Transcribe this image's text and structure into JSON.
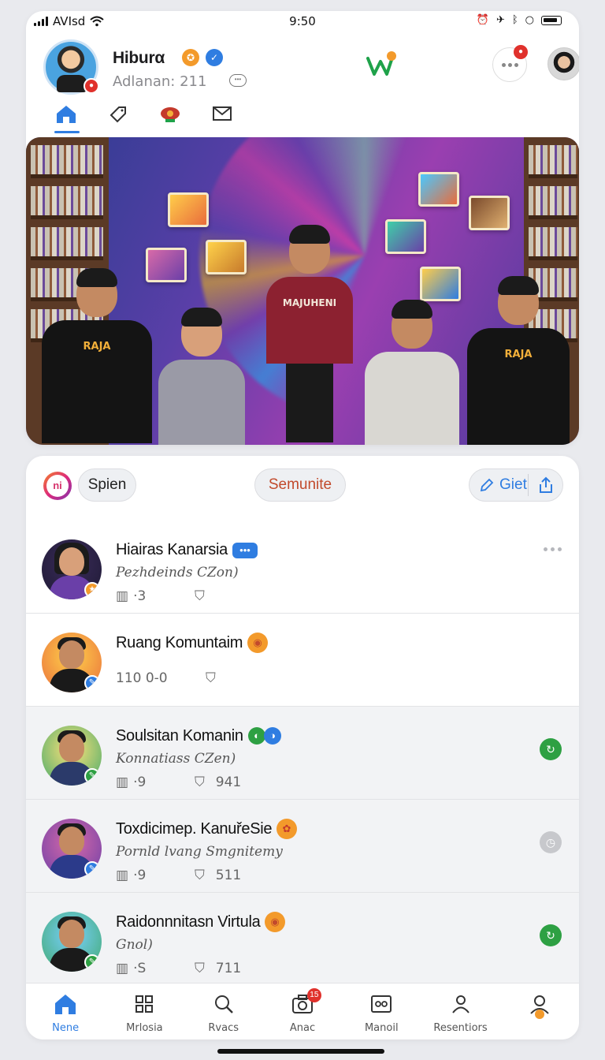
{
  "status_bar": {
    "carrier": "AVIsd",
    "time": "9:50"
  },
  "profile": {
    "name": "Hiburα",
    "subtitle": "Adlanan: 211"
  },
  "filters": {
    "spen": "Spien",
    "semunite": "Semunite",
    "giet": "Giet"
  },
  "list": [
    {
      "title": "Hiairas Kanarsia",
      "subtitle": "Pezhdeinds CZon)",
      "meta_a": "·3",
      "meta_b": "",
      "right": "more",
      "shaded": false
    },
    {
      "title": "Ruang Komuntaim",
      "subtitle": "",
      "meta_a": "110 0-0",
      "meta_b": "",
      "right": "",
      "shaded": false
    },
    {
      "title": "Soulsitan Komanin",
      "subtitle": "Konnatiass CZen)",
      "meta_a": "·9",
      "meta_b": "941",
      "right": "green",
      "shaded": true
    },
    {
      "title": "Toxdicimep. KanuřeSie",
      "subtitle": "Pornld lvang Smgnitemy",
      "meta_a": "·9",
      "meta_b": "511",
      "right": "gray",
      "shaded": true
    },
    {
      "title": "Raidonnnitasn Virtula",
      "subtitle": "Gnol)",
      "meta_a": "·S",
      "meta_b": "711",
      "right": "green",
      "shaded": true
    }
  ],
  "bottom_nav": [
    {
      "label": "Nene",
      "icon": "home-icon",
      "active": true
    },
    {
      "label": "Mrlosia",
      "icon": "grid-icon",
      "active": false
    },
    {
      "label": "Rvacs",
      "icon": "search-icon",
      "active": false
    },
    {
      "label": "Anac",
      "icon": "camera-icon",
      "active": false,
      "badge": "15"
    },
    {
      "label": "Manoil",
      "icon": "inbox-icon",
      "active": false
    },
    {
      "label": "Resentiors",
      "icon": "people-icon",
      "active": false
    },
    {
      "label": "",
      "icon": "profile-icon",
      "active": false
    }
  ],
  "hero": {
    "shirt_text_center": "MAJUHENI",
    "shirt_text_side": "RAJA"
  },
  "colors": {
    "accent": "#2f7de1",
    "alert": "#e0312c",
    "green": "#2ea043"
  }
}
